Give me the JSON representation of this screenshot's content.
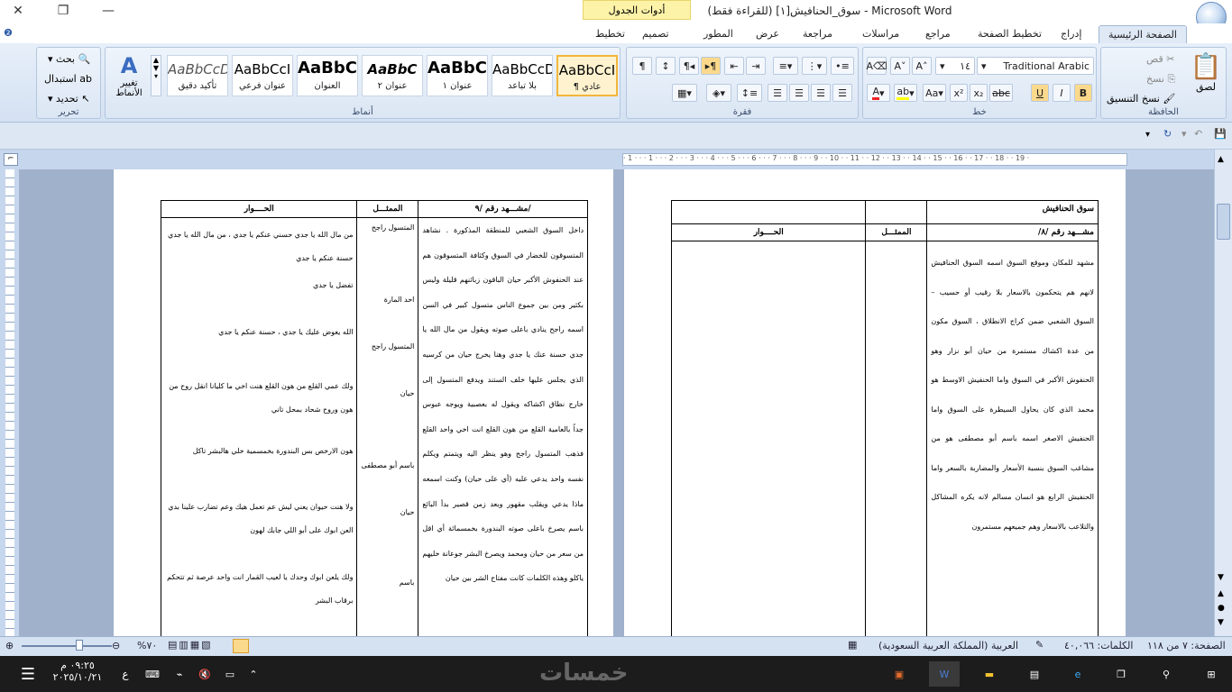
{
  "window": {
    "title": "سوق_الحنافيش[١] (للقراءة فقط) - Microsoft Word",
    "context_tab": "أدوات الجدول"
  },
  "tabs": [
    "الصفحة الرئيسية",
    "إدراج",
    "تخطيط الصفحة",
    "مراجع",
    "مراسلات",
    "مراجعة",
    "عرض",
    "المطور",
    "تصميم",
    "تخطيط"
  ],
  "ribbon": {
    "clipboard": {
      "label": "الحافظة",
      "paste": "لصق",
      "cut": "قص",
      "copy": "نسخ",
      "format_painter": "نسخ التنسيق"
    },
    "font": {
      "label": "خط",
      "font_name": "Traditional Arabic",
      "font_size": "١٤"
    },
    "paragraph": {
      "label": "فقرة"
    },
    "styles": {
      "label": "أنماط",
      "items": [
        {
          "sample": "AaBbCcI",
          "name": "¶ عادي"
        },
        {
          "sample": "AaBbCcD",
          "name": "بلا تباعد"
        },
        {
          "sample": "AaBbC",
          "name": "عنوان ١"
        },
        {
          "sample": "AaBbC",
          "name": "عنوان ٢"
        },
        {
          "sample": "AaBbC",
          "name": "العنوان"
        },
        {
          "sample": "AaBbCcI",
          "name": "عنوان فرعي"
        },
        {
          "sample": "AaBbCcD",
          "name": "تأكيد دقيق"
        }
      ],
      "change_styles": "تغيير الأنماط"
    },
    "editing": {
      "label": "تحرير",
      "find": "بحث",
      "replace": "استبدال",
      "select": "تحديد"
    }
  },
  "ruler": {
    "marks": "· 1 · · · 1 · · · 2 · · · 3 · · · 4 · · · 5 · · · 6 · · · 7 · · · 8 · · · 9 · · 10 · · 11 · · 12 · · 13 · · 14 · · 15 · · 16 · · 17 · · 18 · · 19 ·"
  },
  "page_left": {
    "title": "سوق الحنافيش",
    "scene": "مشـــهد رقم /٨/",
    "actor": "الممثـــل",
    "dialog": "الحــــوار",
    "body": "مشهد للمكان وموقع السوق اسمه السوق الحنافيش لانهم هم يتحكمون بالاسعار بلا رقيب أو حسيب – السوق الشعبي ضمن كراج الانطلاق ، السوق مكون من عدة اكشاك مستمرة من حيان أبو نزار وهو الحنفوش الأكبر في السوق واما الحنفيش الاوسط هو محمد الذي كان يحاول السيطرة على السوق واما الحنفيش الاصغر اسمه باسم أبو مصطفى هو من مشاغب السوق بنسبة الأسعار والمضاربة بالسعر واما الحنفيش الرابع هو انسان مسالم لانه يكره المشاكل والتلاعب بالاسعار وهم جميعهم مستمرون"
  },
  "page_right": {
    "scene": "مشـــهد رقم /٩/",
    "actor": "الممثـــل",
    "dialog": "الحــــوار",
    "body": "داخل السوق الشعبي للمنطقة المذكورة . نشاهد المتسوقون للخضار في السوق وكثافة المتسوقون هم عند الحنفوش الأكبر حيان الباقون زبائنهم قليلة وليس بكثير ومن بين جموع الناس متسول كبير في السن اسمه راجح ينادي باعلى صوته ويقول من مال الله يا جدي حسنة عنك يا جدي وهنا يخرج حيان من كرسيه الذي يجلس عليها خلف الستند ويدفع المتسول إلى خارج نطاق اكشاكه ويقول له بعصبية ويوجه عبوس جداً بالعامية القلع من هون القلع انت اخي واحد القلع فذهب المتسول راجح وهو ينظر اليه ويتمتم ويكلم نفسه واحد يدعي عليه (أي على حيان) وكنت اسمعه ماذا يدعي ويقلب مقهور وبعد زمن قصير بدأ البائع باسم يصرخ باعلى صوته البندورة بخمسمائة أي اقل من سعر من حيان ومحمد ويصرخ البشر جوعانة خليهم ياكلو وهذه الكلمات كانت مفتاح الشر بين حيان",
    "rows": [
      {
        "actor": "المتسول راجح",
        "line": "من مال الله يا جدي حسني عنكم يا جدي ، من مال الله يا جدي حسنة عنكم يا جدي"
      },
      {
        "actor": "احد المارة",
        "line": "تفضل يا جدي"
      },
      {
        "actor": "المتسول راجح",
        "line": "الله يعوض عليك يا جدي ، حسنة عنكم يا جدي"
      },
      {
        "actor": "حيان",
        "line": "ولك عمي القلع من هون القلع هنت اخي ما كليانا انقل روح من هون وروح شحاد بمحل تاني"
      },
      {
        "actor": "باسم أبو مصطفى",
        "line": "هون الارخص بس البندورة بخمسمية خلي هالبشر تاكل"
      },
      {
        "actor": "حيان",
        "line": "ولا هنت حيوان يعني ليش عم تعمل هيك وعم تضارب علينا بدي العن ابوك على أبو اللي جابك لهون"
      },
      {
        "actor": "باسم",
        "line": "ولك يلعن ابوك وحدك يا لعيب القمار انت واحد عرصة ثم تتحكم برقاب البشر"
      }
    ]
  },
  "status": {
    "page": "الصفحة: ٧ من ١١٨",
    "words": "الكلمات: ٤٠,٠٦٦",
    "language": "العربية (المملكة العربية السعودية)",
    "zoom": "%٧٠"
  },
  "taskbar": {
    "time": "٠٩:٢٥ م",
    "date": "٢٠٢٥/١٠/٢١",
    "lang": "ع",
    "watermark": "خمسات"
  },
  "colors": {
    "ribbon": "#dbe6f4",
    "docbg": "#9fb1cb",
    "taskbar": "#1c1c1c",
    "highlight": "#fff3cf"
  }
}
